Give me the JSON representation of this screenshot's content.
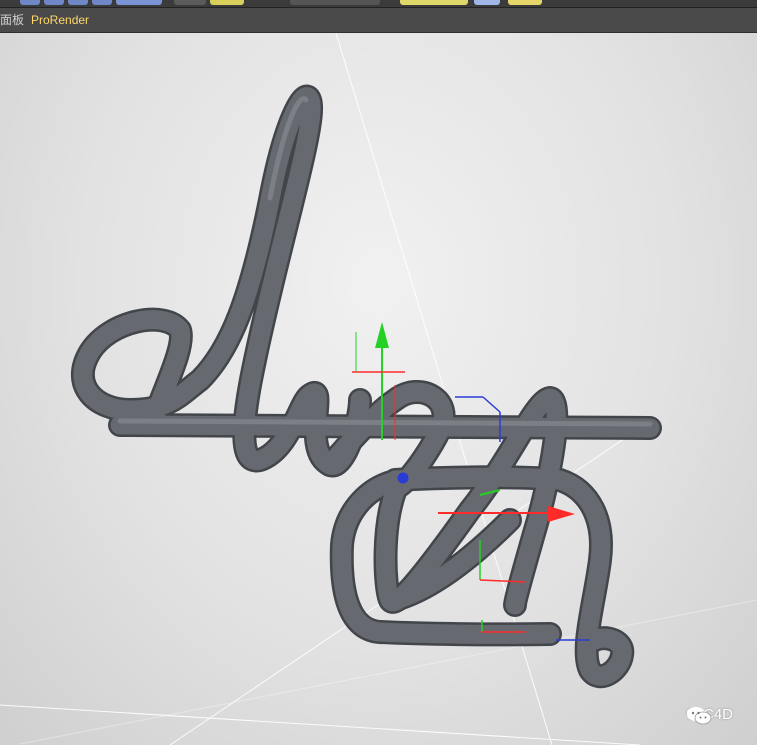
{
  "toolbar": {
    "icons": [
      "tool-icon",
      "tool-icon",
      "tool-icon",
      "tool-icon",
      "tool-icon",
      "tool-icon",
      "tool-icon",
      "tool-icon",
      "tool-icon",
      "tool-icon",
      "tool-icon"
    ]
  },
  "menubar": {
    "items": [
      {
        "label": "面板",
        "color": "#d0d0d0"
      },
      {
        "label": "ProRender",
        "color": "#ffd86a"
      }
    ]
  },
  "viewport": {
    "object": "3D tube text spline",
    "gizmo_axes": [
      "x-axis-arrow",
      "y-axis-arrow",
      "z-axis"
    ],
    "colors": {
      "x": "#ff2a2a",
      "y": "#26d126",
      "z": "#2b3bd6",
      "tube": "#5d6167"
    }
  },
  "watermark": {
    "text": "91C4D",
    "icon": "wechat-icon"
  }
}
